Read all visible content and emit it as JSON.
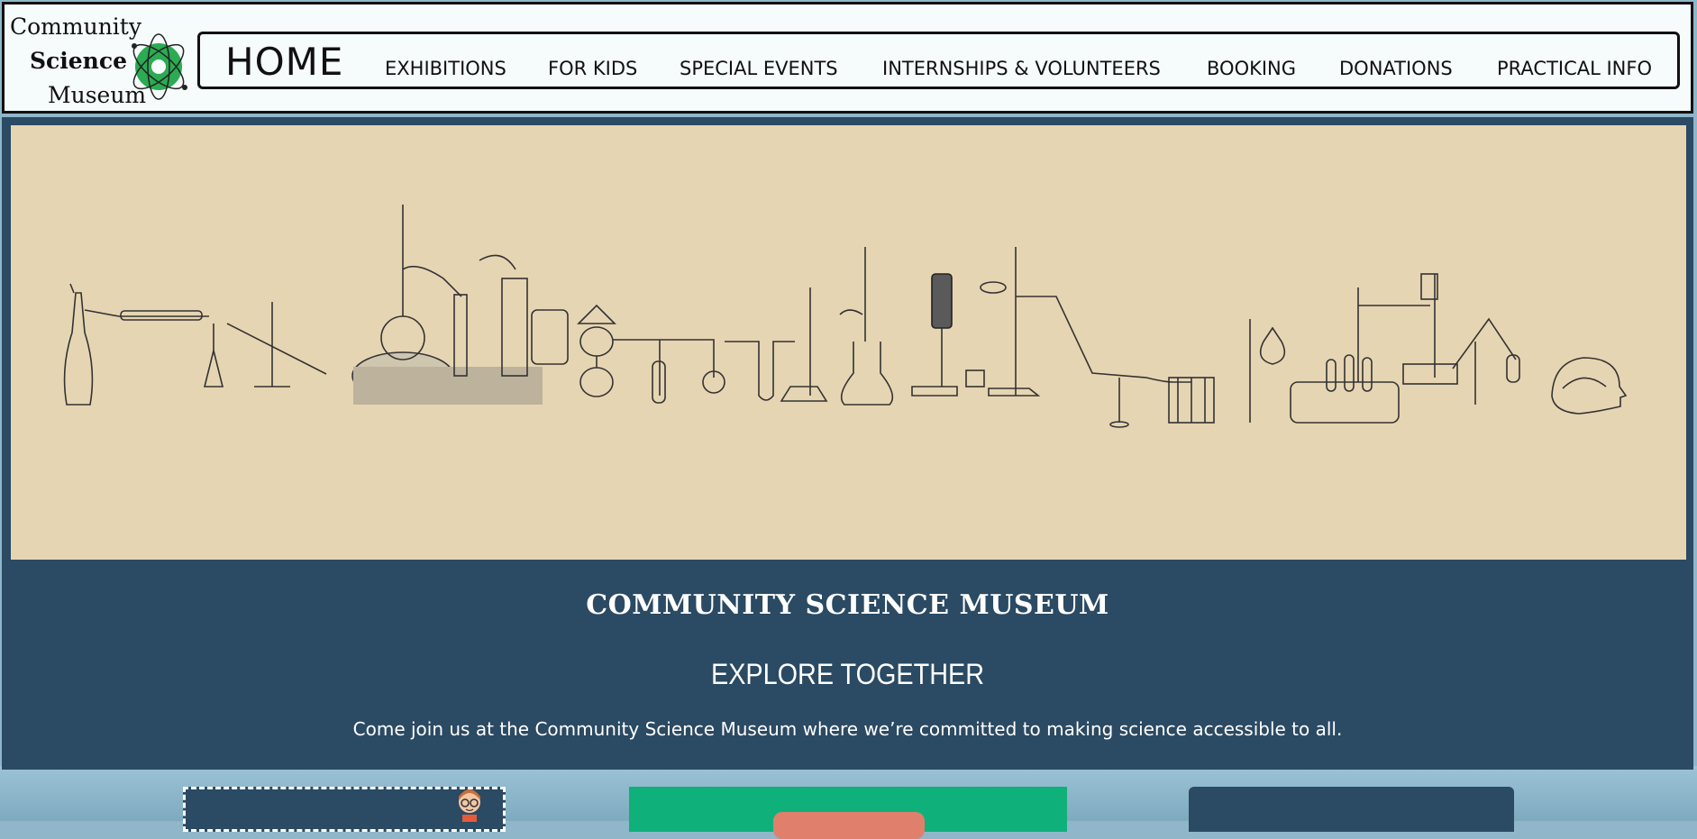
{
  "logo": {
    "line1": "Community",
    "line2": "Science",
    "line3": "Museum"
  },
  "nav": {
    "home": "HOME",
    "items": [
      "EXHIBITIONS",
      "FOR KIDS",
      "SPECIAL EVENTS",
      "INTERNSHIPS & VOLUNTEERS",
      "BOOKING",
      "DONATIONS",
      "PRACTICAL INFO"
    ]
  },
  "hero": {
    "title": "COMMUNITY SCIENCE MUSEUM",
    "subtitle": "EXPLORE TOGETHER",
    "tagline": "Come join us at the Community Science Museum where we’re committed to making science accessible to all."
  },
  "colors": {
    "header_bg": "#f6fbfb",
    "panel_bg": "#2b4a63",
    "hero_bg": "#e6d5b3",
    "card_green": "#0fb07a",
    "atom_green": "#2bab52"
  }
}
